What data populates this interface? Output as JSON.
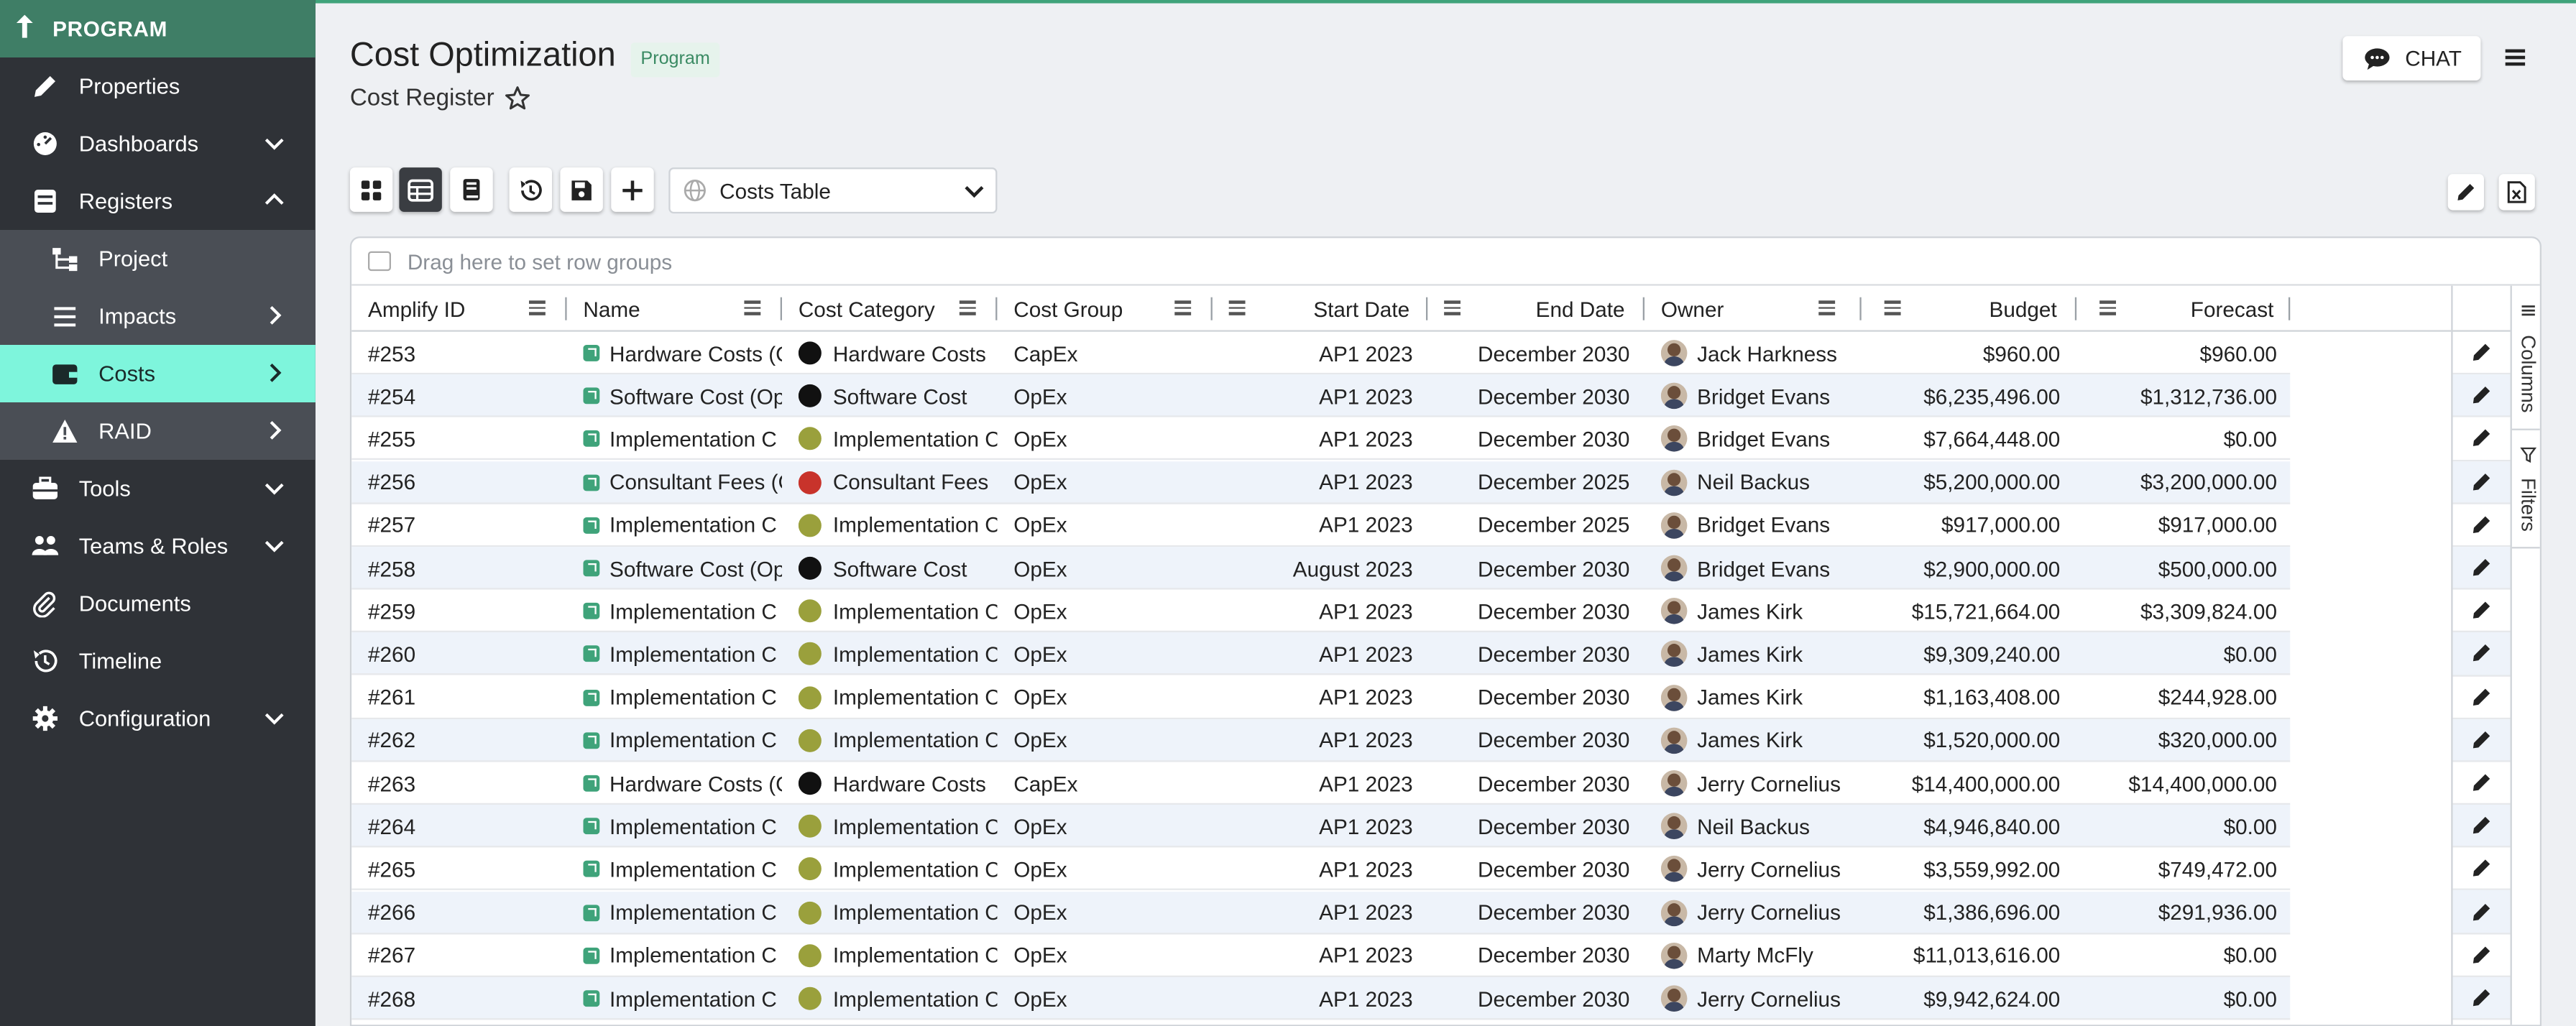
{
  "sidebar": {
    "header": "PROGRAM",
    "items": [
      {
        "label": "Properties",
        "icon": "pencil-icon"
      },
      {
        "label": "Dashboards",
        "icon": "dashboard-icon",
        "chevron": "down"
      },
      {
        "label": "Registers",
        "icon": "register-icon",
        "chevron": "up"
      },
      {
        "label": "Project",
        "icon": "hierarchy-icon",
        "sub": true
      },
      {
        "label": "Impacts",
        "icon": "list-icon",
        "sub": true,
        "chevron": "right"
      },
      {
        "label": "Costs",
        "icon": "wallet-icon",
        "sub": true,
        "active": true,
        "chevron": "right"
      },
      {
        "label": "RAID",
        "icon": "warning-icon",
        "sub": true,
        "chevron": "right"
      },
      {
        "label": "Tools",
        "icon": "toolbox-icon",
        "chevron": "down"
      },
      {
        "label": "Teams & Roles",
        "icon": "users-icon",
        "chevron": "down"
      },
      {
        "label": "Documents",
        "icon": "paperclip-icon"
      },
      {
        "label": "Timeline",
        "icon": "history-icon"
      },
      {
        "label": "Configuration",
        "icon": "gear-icon",
        "chevron": "down"
      }
    ]
  },
  "header": {
    "title": "Cost Optimization",
    "badge": "Program",
    "subtitle": "Cost Register",
    "chat_label": "CHAT"
  },
  "toolbar": {
    "view_select": "Costs Table"
  },
  "grid": {
    "group_placeholder": "Drag here to set row groups",
    "columns": [
      "Amplify ID",
      "Name",
      "Cost Category",
      "Cost Group",
      "Start Date",
      "End Date",
      "Owner",
      "Budget",
      "Forecast"
    ],
    "side_tabs": [
      "Columns",
      "Filters"
    ],
    "rows": [
      {
        "id": "#253",
        "name": "Hardware Costs (C",
        "category": "Hardware Costs",
        "cat_color": "#111111",
        "group": "CapEx",
        "start": "AP1 2023",
        "end": "December 2030",
        "owner": "Jack Harkness",
        "budget": "$960.00",
        "forecast": "$960.00"
      },
      {
        "id": "#254",
        "name": "Software Cost (Op",
        "category": "Software Cost",
        "cat_color": "#111111",
        "group": "OpEx",
        "start": "AP1 2023",
        "end": "December 2030",
        "owner": "Bridget Evans",
        "budget": "$6,235,496.00",
        "forecast": "$1,312,736.00"
      },
      {
        "id": "#255",
        "name": "Implementation C",
        "category": "Implementation C",
        "cat_color": "#9aa03c",
        "group": "OpEx",
        "start": "AP1 2023",
        "end": "December 2030",
        "owner": "Bridget Evans",
        "budget": "$7,664,448.00",
        "forecast": "$0.00"
      },
      {
        "id": "#256",
        "name": "Consultant Fees (C",
        "category": "Consultant Fees",
        "cat_color": "#c8332b",
        "group": "OpEx",
        "start": "AP1 2023",
        "end": "December 2025",
        "owner": "Neil Backus",
        "budget": "$5,200,000.00",
        "forecast": "$3,200,000.00"
      },
      {
        "id": "#257",
        "name": "Implementation C",
        "category": "Implementation C",
        "cat_color": "#9aa03c",
        "group": "OpEx",
        "start": "AP1 2023",
        "end": "December 2025",
        "owner": "Bridget Evans",
        "budget": "$917,000.00",
        "forecast": "$917,000.00"
      },
      {
        "id": "#258",
        "name": "Software Cost (Op",
        "category": "Software Cost",
        "cat_color": "#111111",
        "group": "OpEx",
        "start": "August 2023",
        "end": "December 2030",
        "owner": "Bridget Evans",
        "budget": "$2,900,000.00",
        "forecast": "$500,000.00"
      },
      {
        "id": "#259",
        "name": "Implementation C",
        "category": "Implementation C",
        "cat_color": "#9aa03c",
        "group": "OpEx",
        "start": "AP1 2023",
        "end": "December 2030",
        "owner": "James Kirk",
        "budget": "$15,721,664.00",
        "forecast": "$3,309,824.00"
      },
      {
        "id": "#260",
        "name": "Implementation C",
        "category": "Implementation C",
        "cat_color": "#9aa03c",
        "group": "OpEx",
        "start": "AP1 2023",
        "end": "December 2030",
        "owner": "James Kirk",
        "budget": "$9,309,240.00",
        "forecast": "$0.00"
      },
      {
        "id": "#261",
        "name": "Implementation C",
        "category": "Implementation C",
        "cat_color": "#9aa03c",
        "group": "OpEx",
        "start": "AP1 2023",
        "end": "December 2030",
        "owner": "James Kirk",
        "budget": "$1,163,408.00",
        "forecast": "$244,928.00"
      },
      {
        "id": "#262",
        "name": "Implementation C",
        "category": "Implementation C",
        "cat_color": "#9aa03c",
        "group": "OpEx",
        "start": "AP1 2023",
        "end": "December 2030",
        "owner": "James Kirk",
        "budget": "$1,520,000.00",
        "forecast": "$320,000.00"
      },
      {
        "id": "#263",
        "name": "Hardware Costs (C",
        "category": "Hardware Costs",
        "cat_color": "#111111",
        "group": "CapEx",
        "start": "AP1 2023",
        "end": "December 2030",
        "owner": "Jerry Cornelius",
        "budget": "$14,400,000.00",
        "forecast": "$14,400,000.00"
      },
      {
        "id": "#264",
        "name": "Implementation C",
        "category": "Implementation C",
        "cat_color": "#9aa03c",
        "group": "OpEx",
        "start": "AP1 2023",
        "end": "December 2030",
        "owner": "Neil Backus",
        "budget": "$4,946,840.00",
        "forecast": "$0.00"
      },
      {
        "id": "#265",
        "name": "Implementation C",
        "category": "Implementation C",
        "cat_color": "#9aa03c",
        "group": "OpEx",
        "start": "AP1 2023",
        "end": "December 2030",
        "owner": "Jerry Cornelius",
        "budget": "$3,559,992.00",
        "forecast": "$749,472.00"
      },
      {
        "id": "#266",
        "name": "Implementation C",
        "category": "Implementation C",
        "cat_color": "#9aa03c",
        "group": "OpEx",
        "start": "AP1 2023",
        "end": "December 2030",
        "owner": "Jerry Cornelius",
        "budget": "$1,386,696.00",
        "forecast": "$291,936.00"
      },
      {
        "id": "#267",
        "name": "Implementation C",
        "category": "Implementation C",
        "cat_color": "#9aa03c",
        "group": "OpEx",
        "start": "AP1 2023",
        "end": "December 2030",
        "owner": "Marty McFly",
        "budget": "$11,013,616.00",
        "forecast": "$0.00"
      },
      {
        "id": "#268",
        "name": "Implementation C",
        "category": "Implementation C",
        "cat_color": "#9aa03c",
        "group": "OpEx",
        "start": "AP1 2023",
        "end": "December 2030",
        "owner": "Jerry Cornelius",
        "budget": "$9,942,624.00",
        "forecast": "$0.00"
      }
    ]
  },
  "colors": {
    "brand": "#3f7e66",
    "active_nav": "#7ef5dc",
    "sidebar_bg": "#2f3237"
  }
}
